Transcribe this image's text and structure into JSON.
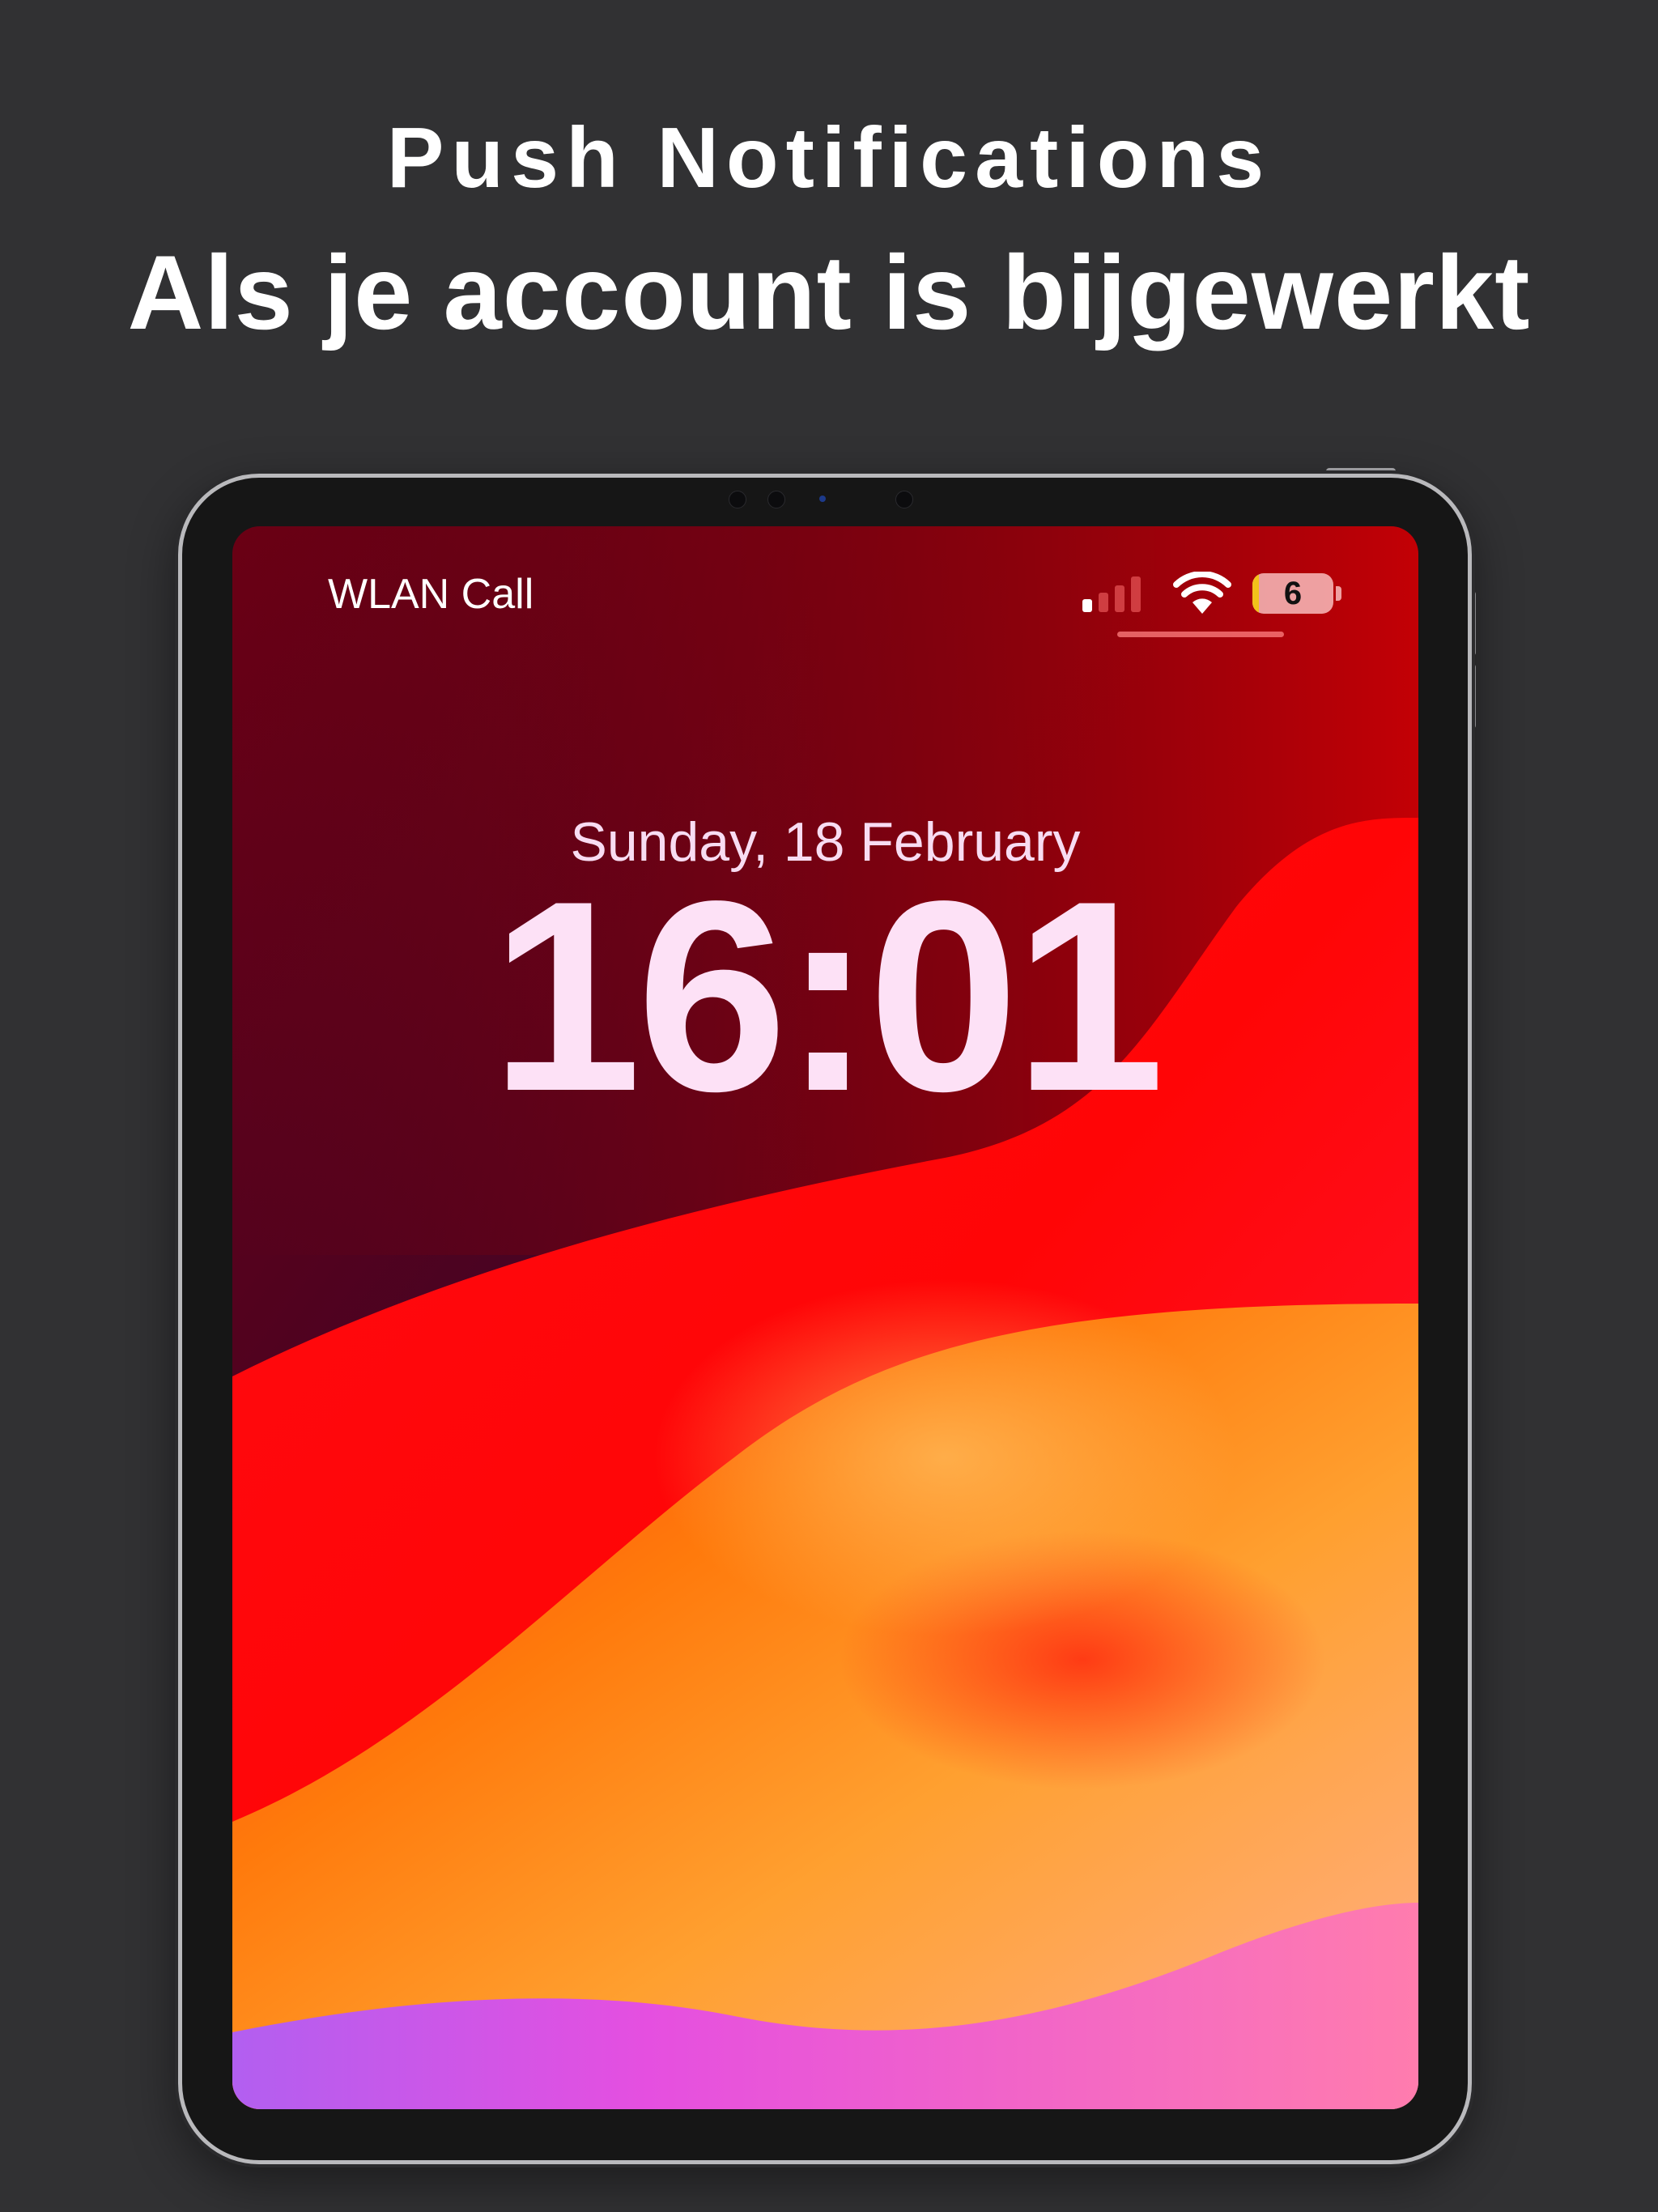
{
  "header": {
    "subtitle": "Push Notifications",
    "headline": "Als je account is bijgewerkt"
  },
  "lock_screen": {
    "carrier_label": "WLAN Call",
    "date": "Sunday, 18 February",
    "time": "16:01",
    "battery_level": "6",
    "status_icons": [
      "signal-icon",
      "wifi-icon",
      "battery-icon"
    ]
  },
  "colors": {
    "page_background": "#313133",
    "device_bezel": "#161616",
    "device_frame": "#b9b9bc",
    "text_primary": "#ffffff",
    "lock_text": "#fde1f6",
    "battery_low": "#f2c21a"
  }
}
